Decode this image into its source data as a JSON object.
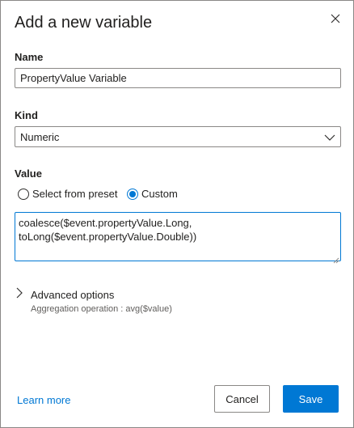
{
  "dialog": {
    "title": "Add a new variable",
    "close_icon": "close-icon"
  },
  "name": {
    "label": "Name",
    "value": "PropertyValue Variable"
  },
  "kind": {
    "label": "Kind",
    "selected": "Numeric",
    "dropdown_icon": "chevron-down-icon"
  },
  "value": {
    "label": "Value",
    "options": [
      {
        "label": "Select from preset",
        "checked": false
      },
      {
        "label": "Custom",
        "checked": true
      }
    ],
    "expression_line1": "coalesce($event.propertyValue.Long,",
    "expression_line2": "toLong($event.propertyValue.Double))"
  },
  "advanced": {
    "label": "Advanced options",
    "expand_icon": "chevron-right-icon",
    "aggregation_text": "Aggregation operation : avg($value)"
  },
  "footer": {
    "learn_more": "Learn more",
    "cancel_label": "Cancel",
    "save_label": "Save"
  },
  "colors": {
    "accent": "#0078d4",
    "border": "#8a8886",
    "text": "#201f1e",
    "secondary_text": "#605e5c"
  }
}
